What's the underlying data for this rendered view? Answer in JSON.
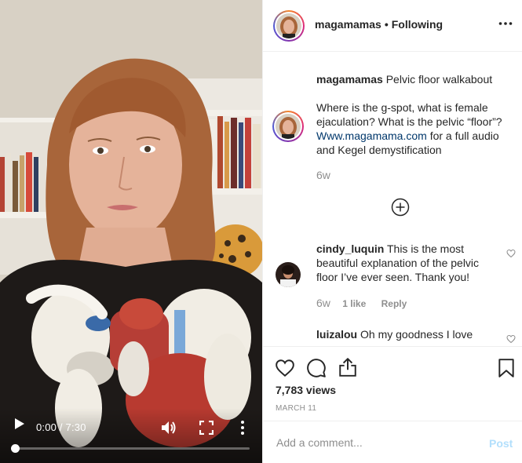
{
  "video": {
    "time_display": "0:00 / 7:30",
    "progress": 0,
    "icons": {
      "play": "play-icon",
      "volume": "volume-icon",
      "fullscreen": "fullscreen-icon",
      "more": "more-vertical-icon"
    }
  },
  "header": {
    "username": "magamamas",
    "separator": "•",
    "follow_status": "Following",
    "more_icon": "more-horizontal-icon"
  },
  "caption": {
    "username": "magamamas",
    "title": "Pelvic floor walkabout",
    "body": "Where is the g-spot, what is female ejaculation? What is the pelvic “floor”?",
    "link": "Www.magamama.com",
    "after_link": "for a full audio and Kegel demystification",
    "age": "6w"
  },
  "load_more_icon": "plus-circle-icon",
  "comments": [
    {
      "username": "cindy_luquin",
      "text": "This is the most beautiful explanation of the pelvic floor I’ve ever seen. Thank you!",
      "age": "6w",
      "likes": "1 like",
      "reply": "Reply"
    },
    {
      "username": "luizalou",
      "text": "Oh my goodness I love"
    }
  ],
  "actions": {
    "views": "7,783 views",
    "date": "MARCH 11",
    "icons": {
      "like": "heart-icon",
      "comment": "comment-icon",
      "share": "share-icon",
      "save": "bookmark-icon"
    }
  },
  "add_comment": {
    "placeholder": "Add a comment...",
    "post_label": "Post"
  },
  "colors": {
    "link": "#00376b",
    "muted": "#8e8e8e",
    "post_disabled": "#b2dffc",
    "story_ring": "#dd2a7b"
  }
}
